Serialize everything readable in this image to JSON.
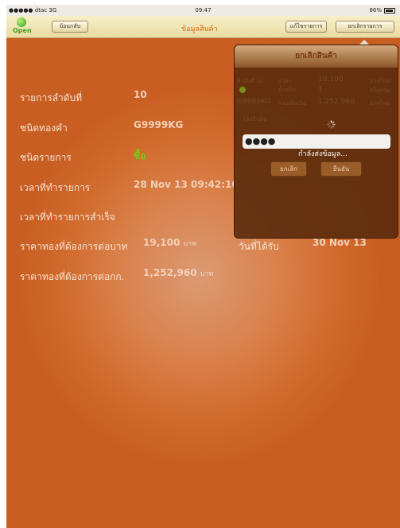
{
  "status": {
    "carrier": "●●●●● dtac  3G",
    "time": "09:47",
    "battery": "86%"
  },
  "nav": {
    "logo_text": "Open",
    "back_label": "ย้อนกลับ",
    "title": "ข้อมูลสินค้า",
    "edit_label": "แก้ไขรายการ",
    "cancel_list_label": "ยกเลิกรายการ"
  },
  "details": {
    "seq_label": "รายการลำดับที่",
    "seq_value": "10",
    "type_label": "ชนิดทองคำ",
    "type_value": "G9999KG",
    "order_label": "ชนิดรายการ",
    "order_value": "ซื้อ",
    "time_label": "เวลาที่ทำรายการ",
    "time_value": "28 Nov 13 09:42:10",
    "done_label": "เวลาที่ทำรายการสำเร็จ",
    "bahtprice_label": "ราคาทองที่ต้องการต่อบาท",
    "bahtprice_value": "19,100",
    "bahtprice_unit": "บาท",
    "receive_label": "วันที่ได้รับ",
    "receive_value": "30 Nov 13",
    "kgprice_label": "ราคาทองที่ต้องการต่อกก.",
    "kgprice_value": "1,252,960",
    "kgprice_unit": "บาท"
  },
  "popup": {
    "title": "ยกเลิกสินค้า",
    "r1": {
      "seq": "ลำดับที่ 10",
      "price_label": "ราคา",
      "price": "19,100",
      "unit": "บาทไทย"
    },
    "r2": {
      "weight_label": "น้ำหนัก",
      "weight": "1",
      "unit": "กิโลกรัม"
    },
    "r3": {
      "code": "G9999KG",
      "total_label": "รวมเป็นเงิน",
      "total": "1,252,960",
      "unit": "บาทไทย"
    },
    "pin_label": "รหัสยืนยัน",
    "pin_value": "●●●●",
    "loading_text": "กำลังส่งข้อมูล...",
    "cancel_label": "ยกเลิก",
    "confirm_label": "ยืนยัน"
  },
  "colors": {
    "background": "#d9804a",
    "nav_title": "#d46a00",
    "accent_green": "#7ec814"
  }
}
